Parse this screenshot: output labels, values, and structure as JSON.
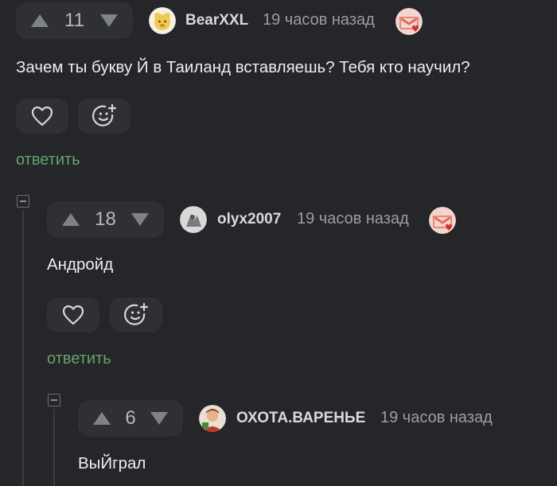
{
  "comments": [
    {
      "votes": "11",
      "username": "BearXXL",
      "time": "19 часов назад",
      "text": "Зачем ты букву Й в Таиланд вставляешь? Тебя кто научил?",
      "reply_label": "ответить",
      "avatar_color": "#f2c94c",
      "badge_icon": "heart-award-icon"
    },
    {
      "votes": "18",
      "username": "olyx2007",
      "time": "19 часов назад",
      "text": "Андройд",
      "reply_label": "ответить",
      "avatar_color": "#9a9a9a",
      "badge_icon": "heart-award-icon"
    },
    {
      "votes": "6",
      "username": "ОХОТА.ВАРЕНЬЕ",
      "time": "19 часов назад",
      "text": "ВыЙграл",
      "avatar_color": "#c0392b"
    }
  ],
  "colors": {
    "background": "#252629",
    "pill": "#2f3034",
    "reply_link": "#65a36b",
    "badge": "#e86a5a"
  }
}
